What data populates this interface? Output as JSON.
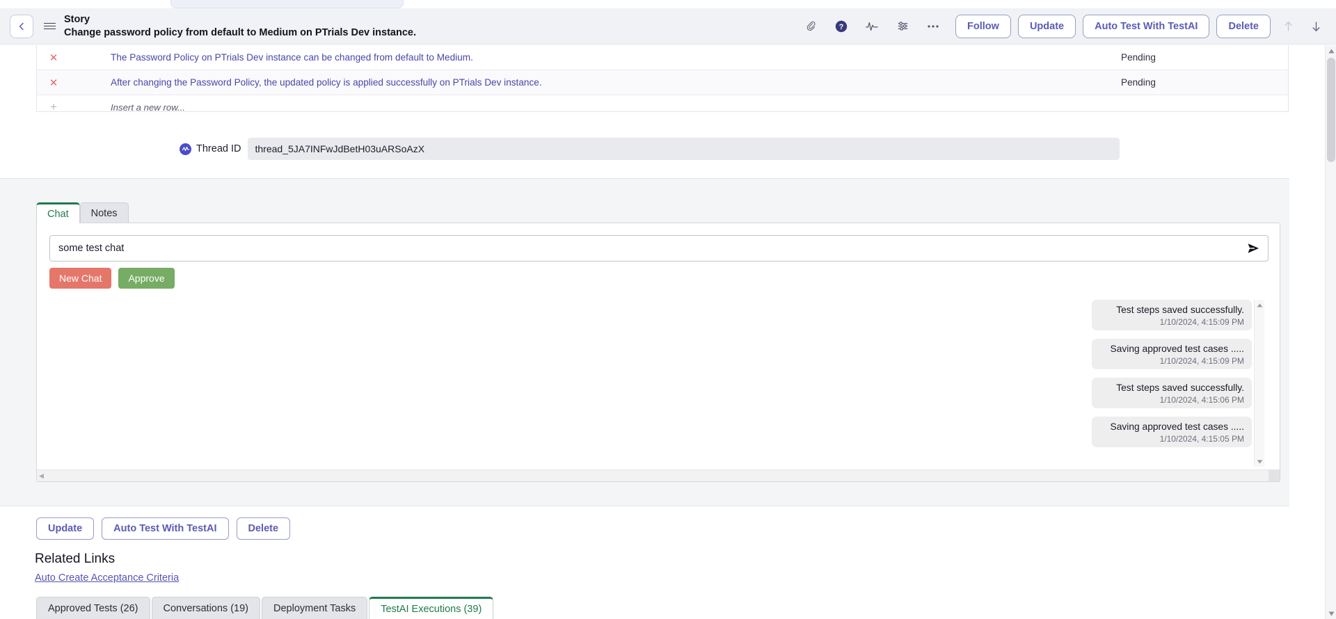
{
  "header": {
    "back_icon": "chevron-left-icon",
    "menu_icon": "hamburger-icon",
    "kind": "Story",
    "summary": "Change password policy from default to Medium on PTrials Dev instance.",
    "icons": [
      {
        "name": "attachment-icon",
        "glyph": "paperclip"
      },
      {
        "name": "help-icon",
        "glyph": "question-circle"
      },
      {
        "name": "activity-icon",
        "glyph": "pulse"
      },
      {
        "name": "filter-settings-icon",
        "glyph": "sliders"
      },
      {
        "name": "more-options-icon",
        "glyph": "ellipsis"
      }
    ],
    "buttons": [
      {
        "label": "Follow",
        "name": "follow-button"
      },
      {
        "label": "Update",
        "name": "update-button"
      },
      {
        "label": "Auto Test With TestAI",
        "name": "auto-test-with-testai-button"
      },
      {
        "label": "Delete",
        "name": "delete-button"
      }
    ],
    "nav_up_icon": "arrow-up-icon",
    "nav_down_icon": "arrow-down-icon"
  },
  "acceptance_criteria": {
    "rows": [
      {
        "mark": "✕",
        "text": "The Password Policy on PTrials Dev instance can be changed from default to Medium.",
        "status": "Pending"
      },
      {
        "mark": "✕",
        "text": "After changing the Password Policy, the updated policy is applied successfully on PTrials Dev instance.",
        "status": "Pending"
      }
    ],
    "new_row": {
      "plus": "+",
      "placeholder": "Insert a new row...",
      "status": ""
    }
  },
  "thread": {
    "icon": "thread-wave-icon",
    "label": "Thread ID",
    "value": "thread_5JA7INFwJdBetH03uARSoAzX"
  },
  "chat_panel": {
    "tabs": [
      {
        "label": "Chat",
        "active": true,
        "name": "tab-chat"
      },
      {
        "label": "Notes",
        "active": false,
        "name": "tab-notes"
      }
    ],
    "input": {
      "value": "some test chat",
      "placeholder": "",
      "send_icon": "send-arrow-icon"
    },
    "actions": [
      {
        "label": "New Chat",
        "name": "new-chat-button",
        "color": "#e4776a"
      },
      {
        "label": "Approve",
        "name": "approve-button",
        "color": "#76ac63"
      }
    ],
    "messages": [
      {
        "text": "Test steps saved successfully.",
        "time": "1/10/2024, 4:15:09 PM"
      },
      {
        "text": "Saving approved test cases .....",
        "time": "1/10/2024, 4:15:09 PM"
      },
      {
        "text": "Test steps saved successfully.",
        "time": "1/10/2024, 4:15:06 PM"
      },
      {
        "text": "Saving approved test cases .....",
        "time": "1/10/2024, 4:15:05 PM"
      }
    ],
    "scroll_up_icon": "triangle-up-icon",
    "scroll_down_icon": "triangle-down-icon",
    "hscroll_left_icon": "triangle-left-icon",
    "hscroll_right_icon": "triangle-right-icon"
  },
  "bottom_actions": [
    {
      "label": "Update",
      "name": "update-button-bottom"
    },
    {
      "label": "Auto Test With TestAI",
      "name": "auto-test-with-testai-button-bottom"
    },
    {
      "label": "Delete",
      "name": "delete-button-bottom"
    }
  ],
  "related_links": {
    "title": "Related Links",
    "links": [
      {
        "label": "Auto Create Acceptance Criteria",
        "name": "auto-create-acceptance-criteria-link"
      }
    ]
  },
  "bottom_tabs": [
    {
      "label": "Approved Tests (26)",
      "active": false,
      "name": "tab-approved-tests"
    },
    {
      "label": "Conversations (19)",
      "active": false,
      "name": "tab-conversations"
    },
    {
      "label": "Deployment Tasks",
      "active": false,
      "name": "tab-deployment-tasks"
    },
    {
      "label": "TestAI Executions (39)",
      "active": true,
      "name": "tab-testai-executions"
    }
  ],
  "colors": {
    "accent_purple": "#5b5bb5",
    "tab_active_green": "#1f7a4d",
    "link_blue": "#4747a8",
    "new_chat_red": "#e4776a",
    "approve_green": "#76ac63",
    "criteria_mark_red": "#e06c6c",
    "header_bg": "#f1f2f5"
  }
}
